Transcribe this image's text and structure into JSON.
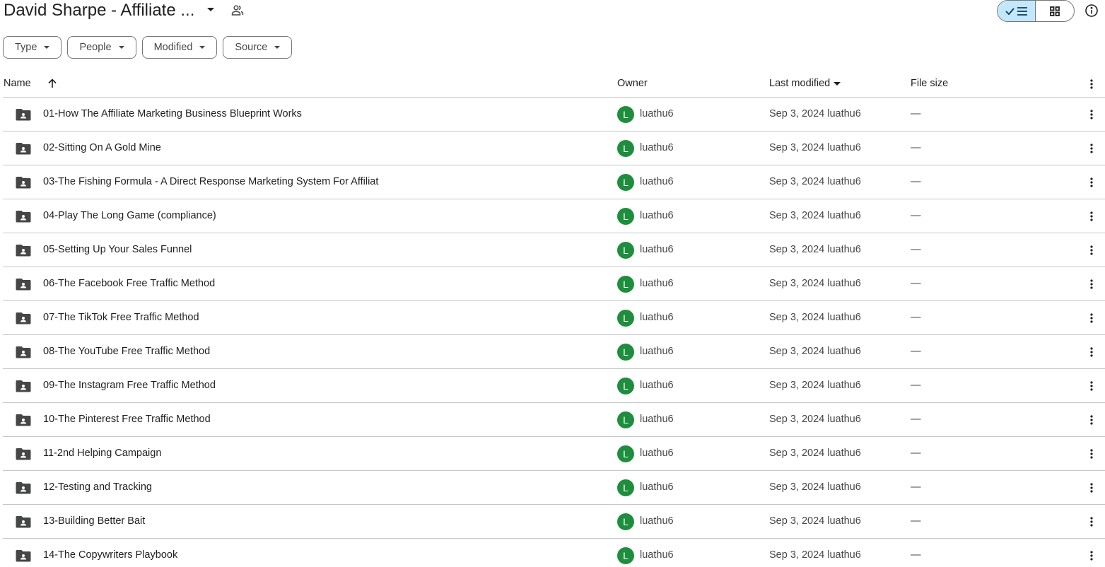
{
  "header": {
    "title": "David Sharpe - Affiliate ...",
    "title_caret_icon": "arrow-drop-down-icon",
    "share_icon": "people-icon",
    "view_toggle": {
      "list_icon": "check-list-icon",
      "grid_icon": "grid-icon",
      "active": "list",
      "active_color": "#c2e7ff"
    },
    "info_icon": "info-icon"
  },
  "filters": [
    {
      "label": "Type"
    },
    {
      "label": "People"
    },
    {
      "label": "Modified"
    },
    {
      "label": "Source"
    }
  ],
  "table": {
    "columns": {
      "name": "Name",
      "owner": "Owner",
      "modified": "Last modified",
      "size": "File size"
    },
    "sort": {
      "column": "name",
      "direction": "ascending"
    },
    "rows": [
      {
        "name": "01-How The Affiliate Marketing Business Blueprint Works",
        "owner_initial": "L",
        "owner": "luathu6",
        "modified": "Sep 3, 2024 luathu6",
        "size": "—"
      },
      {
        "name": "02-Sitting On A Gold Mine",
        "owner_initial": "L",
        "owner": "luathu6",
        "modified": "Sep 3, 2024 luathu6",
        "size": "—"
      },
      {
        "name": "03-The Fishing Formula - A Direct Response Marketing System For Affiliat",
        "owner_initial": "L",
        "owner": "luathu6",
        "modified": "Sep 3, 2024 luathu6",
        "size": "—"
      },
      {
        "name": "04-Play The Long Game (compliance)",
        "owner_initial": "L",
        "owner": "luathu6",
        "modified": "Sep 3, 2024 luathu6",
        "size": "—"
      },
      {
        "name": "05-Setting Up Your Sales Funnel",
        "owner_initial": "L",
        "owner": "luathu6",
        "modified": "Sep 3, 2024 luathu6",
        "size": "—"
      },
      {
        "name": "06-The Facebook Free Traffic Method",
        "owner_initial": "L",
        "owner": "luathu6",
        "modified": "Sep 3, 2024 luathu6",
        "size": "—"
      },
      {
        "name": "07-The TikTok Free Traffic Method",
        "owner_initial": "L",
        "owner": "luathu6",
        "modified": "Sep 3, 2024 luathu6",
        "size": "—"
      },
      {
        "name": "08-The YouTube Free Traffic Method",
        "owner_initial": "L",
        "owner": "luathu6",
        "modified": "Sep 3, 2024 luathu6",
        "size": "—"
      },
      {
        "name": "09-The Instagram Free Traffic Method",
        "owner_initial": "L",
        "owner": "luathu6",
        "modified": "Sep 3, 2024 luathu6",
        "size": "—"
      },
      {
        "name": "10-The Pinterest Free Traffic Method",
        "owner_initial": "L",
        "owner": "luathu6",
        "modified": "Sep 3, 2024 luathu6",
        "size": "—"
      },
      {
        "name": "11-2nd Helping Campaign",
        "owner_initial": "L",
        "owner": "luathu6",
        "modified": "Sep 3, 2024 luathu6",
        "size": "—"
      },
      {
        "name": "12-Testing and Tracking",
        "owner_initial": "L",
        "owner": "luathu6",
        "modified": "Sep 3, 2024 luathu6",
        "size": "—"
      },
      {
        "name": "13-Building Better Bait",
        "owner_initial": "L",
        "owner": "luathu6",
        "modified": "Sep 3, 2024 luathu6",
        "size": "—"
      },
      {
        "name": "14-The Copywriters Playbook",
        "owner_initial": "L",
        "owner": "luathu6",
        "modified": "Sep 3, 2024 luathu6",
        "size": "—"
      }
    ]
  },
  "colors": {
    "avatar": "#1e8e3e",
    "folder": "#444746",
    "divider": "#c4c7c5"
  }
}
